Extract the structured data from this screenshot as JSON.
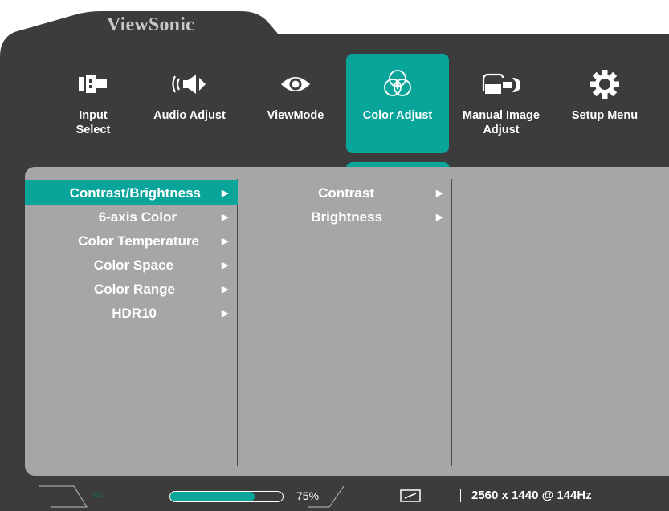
{
  "brand": "ViewSonic",
  "colors": {
    "accent": "#0aa59a",
    "frame": "#3c3c3c",
    "panel": "#a6a6a8"
  },
  "tabs": [
    {
      "label": "Input\nSelect",
      "icon": "input-select-icon",
      "active": false
    },
    {
      "label": "Audio Adjust",
      "icon": "speaker-icon",
      "active": false
    },
    {
      "label": "ViewMode",
      "icon": "eye-icon",
      "active": false
    },
    {
      "label": "Color Adjust",
      "icon": "color-circles-icon",
      "active": true
    },
    {
      "label": "Manual Image\nAdjust",
      "icon": "hand-wrench-icon",
      "active": false
    },
    {
      "label": "Setup Menu",
      "icon": "gear-icon",
      "active": false
    }
  ],
  "menu": {
    "items": [
      {
        "label": "Contrast/Brightness",
        "arrow": "▶",
        "selected": true
      },
      {
        "label": "6-axis Color",
        "arrow": "▶",
        "selected": false
      },
      {
        "label": "Color Temperature",
        "arrow": "▶",
        "selected": false
      },
      {
        "label": "Color Space",
        "arrow": "▶",
        "selected": false
      },
      {
        "label": "Color Range",
        "arrow": "▶",
        "selected": false
      },
      {
        "label": "HDR10",
        "arrow": "▶",
        "selected": false
      }
    ],
    "submenu": [
      {
        "label": "Contrast",
        "arrow": "▶"
      },
      {
        "label": "Brightness",
        "arrow": "▶"
      }
    ]
  },
  "status": {
    "eco_label": "eco",
    "volume_percent": 75,
    "volume_text": "75%",
    "resolution": "2560 x 1440 @ 144Hz"
  }
}
